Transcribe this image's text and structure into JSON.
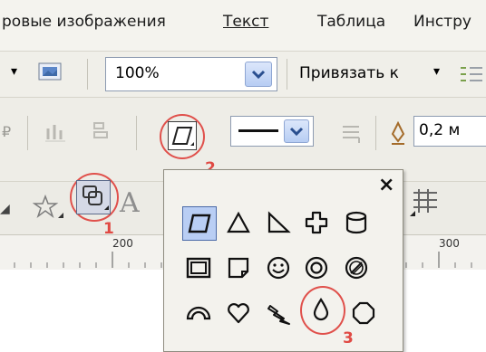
{
  "menu": {
    "items": [
      "ровые изображения",
      "Текст",
      "Таблица",
      "Инстру"
    ]
  },
  "toolbar": {
    "zoom_value": "100%",
    "snap_label": "Привязать к",
    "outline_width": "0,2 м"
  },
  "ruler": {
    "ticks": [
      "200",
      "300"
    ]
  },
  "annotations": {
    "marker_1": "1",
    "marker_2": "2",
    "marker_3": "3"
  },
  "flyout": {
    "close_glyph": "×",
    "rows": [
      [
        "parallelogram-shape",
        "triangle-shape",
        "right-triangle-shape",
        "cross-shape",
        "cylinder-shape"
      ],
      [
        "frame-shape",
        "folded-corner-shape",
        "smiley-shape",
        "donut-shape",
        "no-symbol-shape"
      ],
      [
        "arch-shape",
        "heart-shape",
        "lightning-shape",
        "drop-shape",
        "octagon-shape"
      ]
    ]
  },
  "colors": {
    "accent_red": "#e0504b",
    "selection_blue": "#b9cef4"
  }
}
